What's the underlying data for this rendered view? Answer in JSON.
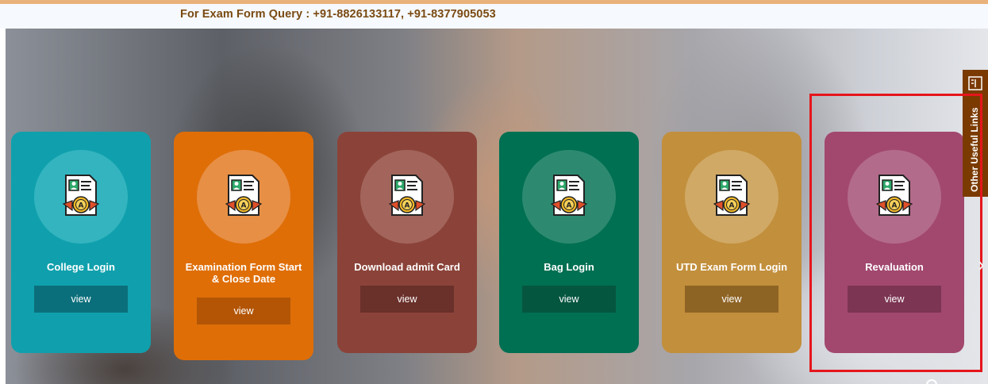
{
  "header": {
    "query_text": "For Exam Form Query : +91-8826133117, +91-8377905053"
  },
  "cards": [
    {
      "title": "College Login",
      "button": "view",
      "icon": "certificate-icon"
    },
    {
      "title": "Examination Form Start & Close Date",
      "button": "view",
      "icon": "certificate-icon"
    },
    {
      "title": "Download admit Card",
      "button": "view",
      "icon": "certificate-icon"
    },
    {
      "title": "Bag Login",
      "button": "view",
      "icon": "certificate-icon"
    },
    {
      "title": "UTD Exam Form Login",
      "button": "view",
      "icon": "certificate-icon"
    },
    {
      "title": "Revaluation",
      "button": "view",
      "icon": "certificate-icon"
    }
  ],
  "side_tab": {
    "label": "Other Useful Links",
    "icon": "menu-icon"
  },
  "colors": {
    "card_college_login": "#10a0ad",
    "card_exam_form": "#df6e07",
    "card_admit_card": "#8b4339",
    "card_bag_login": "#007052",
    "card_utd": "#c28f3c",
    "card_revaluation": "#a2486f",
    "highlight_box": "#e5161c"
  }
}
